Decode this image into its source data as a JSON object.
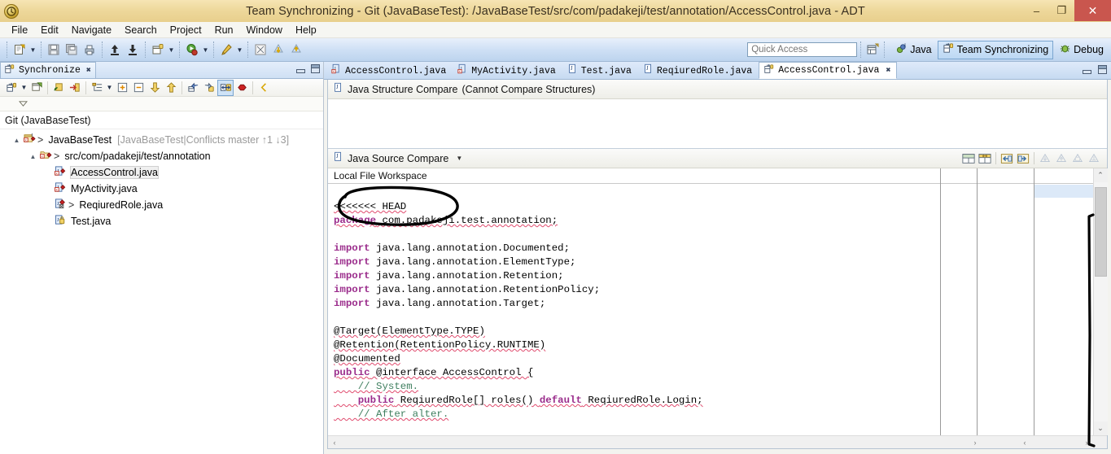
{
  "window": {
    "title": "Team Synchronizing - Git (JavaBaseTest): /JavaBaseTest/src/com/padakeji/test/annotation/AccessControl.java - ADT",
    "app_icon": "adt-icon",
    "minimize": "–",
    "maximize": "❐",
    "close": "✕"
  },
  "menubar": {
    "items": [
      "File",
      "Edit",
      "Navigate",
      "Search",
      "Project",
      "Run",
      "Window",
      "Help"
    ]
  },
  "toolbar": {
    "icons": [
      "new-wizard-icon",
      "save-icon",
      "save-all-icon",
      "print-icon",
      "commit-push-icon",
      "pull-icon",
      "new-java-package-icon",
      "run-icon",
      "external-tools-icon",
      "search-icon",
      "next-annotation-icon",
      "previous-annotation-icon"
    ],
    "quick_access": {
      "placeholder": "Quick Access",
      "value": ""
    },
    "open_perspective": "open-perspective-icon",
    "perspectives": [
      {
        "label": "Java",
        "icon": "java-perspective-icon",
        "active": false
      },
      {
        "label": "Team Synchronizing",
        "icon": "team-sync-perspective-icon",
        "active": true
      },
      {
        "label": "Debug",
        "icon": "debug-perspective-icon",
        "active": false
      }
    ]
  },
  "sync_view": {
    "tab": {
      "label": "Synchronize",
      "icon": "team-sync-icon",
      "close": "✖"
    },
    "minimize_icon": "minimize-icon",
    "maximize_icon": "maximize-icon",
    "toolbar_icons": [
      "synchronize-icon",
      "synchronize-dropdown",
      "open-sync-wizard-icon",
      "pin-icon",
      "remove-icon",
      "mode-icon",
      "mode-dropdown",
      "expand-all-icon",
      "collapse-all-icon",
      "next-change-icon",
      "previous-change-icon",
      "incoming-mode-icon",
      "outgoing-mode-icon",
      "both-mode-icon",
      "conflicts-mode-icon",
      "previous-icon",
      "view-menu-icon"
    ],
    "root_label": "Git (JavaBaseTest)",
    "tree": [
      {
        "depth": 0,
        "twisty": "▲",
        "icon": "project-conflict-icon",
        "prefix": ">",
        "name": "JavaBaseTest",
        "meta": "[JavaBaseTest|Conflicts master ↑1 ↓3]",
        "selected": false
      },
      {
        "depth": 1,
        "twisty": "▲",
        "icon": "folder-conflict-icon",
        "prefix": ">",
        "name": "src/com/padakeji/test/annotation",
        "meta": "",
        "selected": false
      },
      {
        "depth": 2,
        "twisty": "",
        "icon": "java-file-conflict-icon",
        "prefix": "",
        "name": "AccessControl.java",
        "meta": "",
        "selected": true
      },
      {
        "depth": 2,
        "twisty": "",
        "icon": "java-file-conflict-icon",
        "prefix": "",
        "name": "MyActivity.java",
        "meta": "",
        "selected": false
      },
      {
        "depth": 2,
        "twisty": "",
        "icon": "java-file-outgoing-icon",
        "prefix": ">",
        "name": "ReqiuredRole.java",
        "meta": "",
        "selected": false
      },
      {
        "depth": 2,
        "twisty": "",
        "icon": "java-file-icon",
        "prefix": "",
        "name": "Test.java",
        "meta": "",
        "selected": false
      }
    ]
  },
  "editor": {
    "tabs": [
      {
        "label": "AccessControl.java",
        "icon": "java-file-error-icon",
        "active": false,
        "closable": false
      },
      {
        "label": "MyActivity.java",
        "icon": "java-file-error-icon",
        "active": false,
        "closable": false
      },
      {
        "label": "Test.java",
        "icon": "java-file-icon",
        "active": false,
        "closable": false
      },
      {
        "label": "ReqiuredRole.java",
        "icon": "java-file-icon",
        "active": false,
        "closable": false
      },
      {
        "label": "AccessControl.java",
        "icon": "compare-editor-icon",
        "active": true,
        "closable": true
      }
    ],
    "close_glyph": "✖",
    "minimize_icon": "minimize-icon",
    "maximize_icon": "maximize-icon"
  },
  "structure_compare": {
    "icon": "java-compare-icon",
    "title": "Java Structure Compare",
    "subtitle": "(Cannot Compare Structures)"
  },
  "source_compare": {
    "icon": "java-compare-icon",
    "title": "Java Source Compare",
    "dropdown": "▼",
    "toolbar_icons": [
      "two-pane-layout-icon",
      "three-pane-layout-icon",
      "copy-left-to-right-icon",
      "copy-right-to-left-icon",
      "next-difference-icon",
      "previous-difference-icon",
      "next-change-icon",
      "previous-change-icon"
    ],
    "left_title": "Local File Workspace",
    "code_lines": [
      {
        "text": "<<<<<<< HEAD",
        "style": "error"
      },
      {
        "text": "package com.padakeji.test.annotation;",
        "style": "keyword-first",
        "keyword": "package"
      },
      {
        "text": "",
        "style": "plain"
      },
      {
        "text": "import java.lang.annotation.Documented;",
        "style": "keyword-first",
        "keyword": "import"
      },
      {
        "text": "import java.lang.annotation.ElementType;",
        "style": "keyword-first",
        "keyword": "import"
      },
      {
        "text": "import java.lang.annotation.Retention;",
        "style": "keyword-first",
        "keyword": "import"
      },
      {
        "text": "import java.lang.annotation.RetentionPolicy;",
        "style": "keyword-first",
        "keyword": "import"
      },
      {
        "text": "import java.lang.annotation.Target;",
        "style": "keyword-first",
        "keyword": "import"
      },
      {
        "text": "",
        "style": "plain"
      },
      {
        "text": "@Target(ElementType.TYPE)",
        "style": "error"
      },
      {
        "text": "@Retention(RetentionPolicy.RUNTIME)",
        "style": "error"
      },
      {
        "text": "@Documented",
        "style": "error"
      },
      {
        "text": "public @interface AccessControl {",
        "style": "error-keyword",
        "keyword": "public"
      },
      {
        "text": "    // System.",
        "style": "error-comment"
      },
      {
        "text": "    public ReqiuredRole[] roles() default ReqiuredRole.Login;",
        "style": "error-keyword2"
      },
      {
        "text": "    // After alter.",
        "style": "error-comment"
      }
    ]
  },
  "scrollbars": {
    "vertical_up": "⌃",
    "vertical_down": "⌄",
    "horizontal_left": "‹",
    "horizontal_right": "›"
  },
  "annotations": [
    {
      "name": "ink-ellipse-around-head-marker",
      "shape": "ellipse"
    },
    {
      "name": "ink-vertical-line-near-scrollbar",
      "shape": "line"
    }
  ],
  "colors": {
    "titlebar": "#eed89c",
    "toolbar": "#cfe0f5",
    "accent_selection": "#cfe3f7",
    "conflict_red": "#cc2222",
    "keyword_purple": "#9b2d8c",
    "error_squiggle": "#e04b6e",
    "close_button": "#c9564e"
  }
}
